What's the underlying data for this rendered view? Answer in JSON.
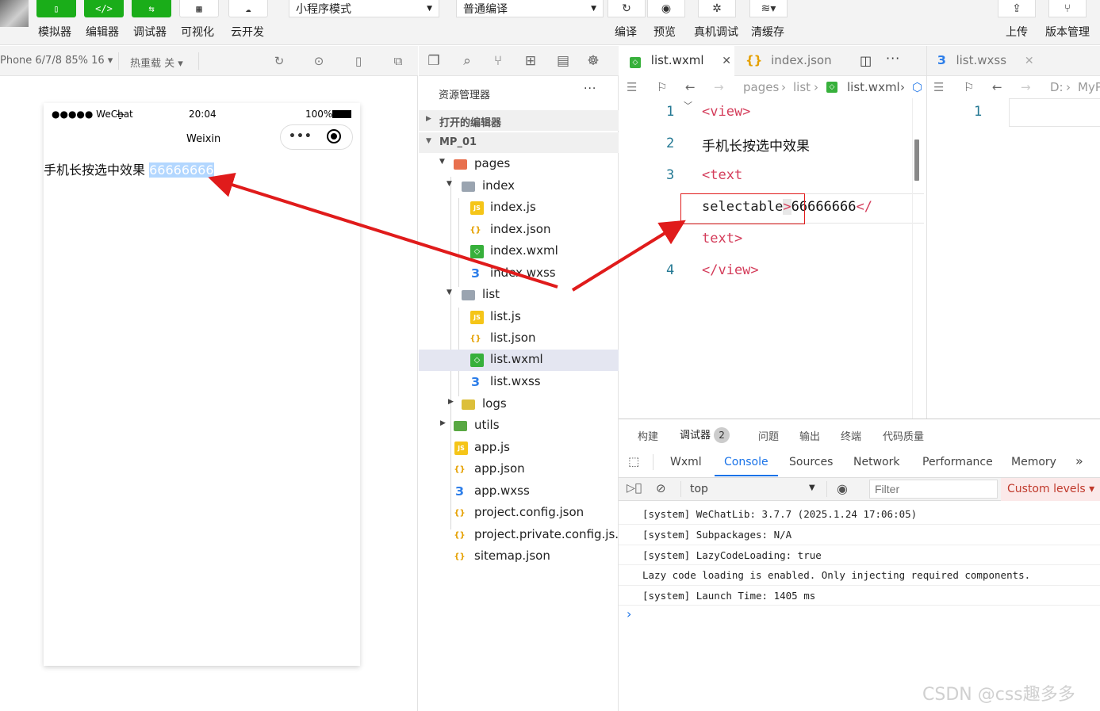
{
  "toolbar": {
    "buttons": [
      {
        "label": "模拟器",
        "icon": "phone-icon"
      },
      {
        "label": "编辑器",
        "icon": "code-icon"
      },
      {
        "label": "调试器",
        "icon": "debug-icon"
      },
      {
        "label": "可视化",
        "icon": "layout-icon"
      },
      {
        "label": "云开发",
        "icon": "cloud-icon"
      }
    ],
    "mode_select": "小程序模式",
    "compile_select": "普通编译",
    "actions": [
      {
        "label": "编译",
        "icon": "refresh-icon"
      },
      {
        "label": "预览",
        "icon": "eye-icon"
      },
      {
        "label": "真机调试",
        "icon": "bug-icon"
      },
      {
        "label": "清缓存",
        "icon": "layers-icon"
      }
    ],
    "right_actions": [
      {
        "label": "上传",
        "icon": "upload-icon"
      },
      {
        "label": "版本管理",
        "icon": "branch-icon"
      }
    ]
  },
  "simulator": {
    "device": "Phone 6/7/8 85% 16 ▾",
    "hot_reload": "热重载 关 ▾",
    "status_carrier": "●●●●● WeChat",
    "status_time": "20:04",
    "status_battery": "100%",
    "nav_title": "Weixin",
    "page_text": "手机长按选中效果 ",
    "selected_text": "66666666"
  },
  "explorer": {
    "title": "资源管理器",
    "more": "···",
    "open_editors": "打开的编辑器",
    "project": "MP_01",
    "tree": [
      {
        "name": "pages",
        "type": "folder-red"
      },
      {
        "name": "index",
        "type": "folder"
      },
      {
        "name": "index.js",
        "type": "js"
      },
      {
        "name": "index.json",
        "type": "json"
      },
      {
        "name": "index.wxml",
        "type": "wxml"
      },
      {
        "name": "index.wxss",
        "type": "wxss"
      },
      {
        "name": "list",
        "type": "folder"
      },
      {
        "name": "list.js",
        "type": "js"
      },
      {
        "name": "list.json",
        "type": "json"
      },
      {
        "name": "list.wxml",
        "type": "wxml"
      },
      {
        "name": "list.wxss",
        "type": "wxss"
      },
      {
        "name": "logs",
        "type": "folder-yel"
      },
      {
        "name": "utils",
        "type": "folder-grn"
      },
      {
        "name": "app.js",
        "type": "js"
      },
      {
        "name": "app.json",
        "type": "json"
      },
      {
        "name": "app.wxss",
        "type": "wxss"
      },
      {
        "name": "project.config.json",
        "type": "json"
      },
      {
        "name": "project.private.config.js...",
        "type": "json"
      },
      {
        "name": "sitemap.json",
        "type": "json"
      }
    ]
  },
  "editor": {
    "tabs": [
      "list.wxml",
      "index.json",
      "list.wxss"
    ],
    "breadcrumb": [
      "pages",
      "list",
      "list.wxml"
    ],
    "breadcrumb2": [
      "D:",
      "MyP"
    ],
    "line_numbers": [
      "1",
      "2",
      "3",
      "4"
    ],
    "code": {
      "l1": "<view>",
      "l2": "手机长按选中效果",
      "l3": "<text",
      "l3b_attr": "selectable",
      "l3b_gt": ">",
      "l3b_val": "66666666",
      "l3b_close": "</",
      "l3c": "text>",
      "l4": "</view>"
    },
    "line_number_right": "1"
  },
  "panel": {
    "tabs": [
      "构建",
      "调试器",
      "问题",
      "输出",
      "终端",
      "代码质量"
    ],
    "debugger_badge": "2",
    "devtools_tabs": [
      "Wxml",
      "Console",
      "Sources",
      "Network",
      "Performance",
      "Memory"
    ],
    "more": "»",
    "context": "top",
    "filter_placeholder": "Filter",
    "levels": "Custom levels ▾",
    "logs": [
      "[system] WeChatLib: 3.7.7 (2025.1.24 17:06:05)",
      "[system] Subpackages: N/A",
      "[system] LazyCodeLoading: true",
      "Lazy code loading is enabled. Only injecting required components.",
      "[system] Launch Time: 1405 ms"
    ],
    "prompt": "›"
  },
  "watermark": "CSDN @css趣多多",
  "colors": {
    "accent_green": "#1aad19",
    "arrow_red": "#e01b1b",
    "tag_red": "#d43c5a",
    "link_blue": "#1a73e8"
  }
}
